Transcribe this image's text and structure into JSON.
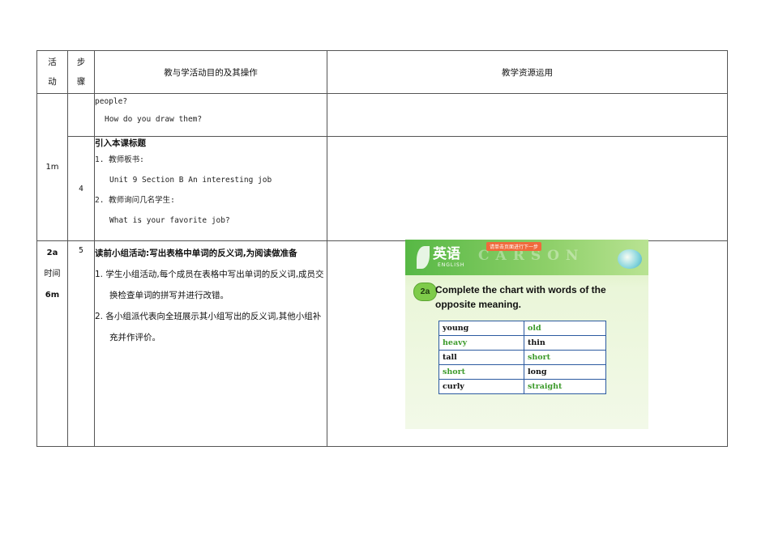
{
  "header": {
    "col1": [
      "活",
      "动"
    ],
    "col2": [
      "步",
      "骤"
    ],
    "col3": "教与学活动目的及其操作",
    "col4": "教学资源运用"
  },
  "block1": {
    "activity": "1m",
    "row1_lines": [
      "people?",
      "How do you draw them?"
    ],
    "row2": {
      "step": "4",
      "title": "引入本课标题",
      "lines": [
        "1. 教师板书:",
        "Unit 9  Section B  An interesting job",
        "2. 教师询问几名学生:",
        "What is your favorite job?"
      ]
    }
  },
  "block2": {
    "activity": [
      "2a",
      "时间",
      "6m"
    ],
    "step": "5",
    "title": "读前小组活动:写出表格中单词的反义词,为阅读做准备",
    "item1": "1. 学生小组活动,每个成员在表格中写出单词的反义词,成员交换检查单词的拼写并进行改错。",
    "item2": "2. 各小组派代表向全班展示其小组写出的反义词,其他小组补充并作评价。"
  },
  "slide": {
    "logo": "英语",
    "logo_sub": "ENGLISH",
    "next_button": "请单击页面进行下一步",
    "watermark": "CARSON",
    "badge": "2a",
    "instruction": "Complete the chart with words of the opposite meaning.",
    "rows": [
      {
        "left": "young",
        "left_color": "black",
        "right": "old",
        "right_color": "green"
      },
      {
        "left": "heavy",
        "left_color": "green",
        "right": "thin",
        "right_color": "black"
      },
      {
        "left": "tall",
        "left_color": "black",
        "right": "short",
        "right_color": "green"
      },
      {
        "left": "short",
        "left_color": "green",
        "right": "long",
        "right_color": "black"
      },
      {
        "left": "curly",
        "left_color": "black",
        "right": "straight",
        "right_color": "green"
      }
    ]
  },
  "colors": {
    "green_word": "#3c9a2a",
    "border": "#555555",
    "slide_table_border": "#2b5aa0"
  }
}
